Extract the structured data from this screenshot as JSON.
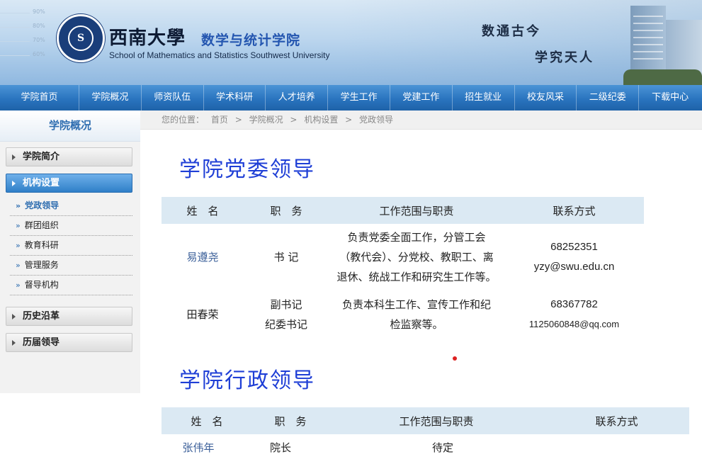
{
  "header": {
    "y_ticks": [
      "90%",
      "80%",
      "70%",
      "60%"
    ],
    "seal_mark": "S",
    "university_name": "西南大學",
    "school_name": "数学与统计学院",
    "school_name_en": "School of Mathematics and Statistics Southwest University",
    "motto_line1": "数通古今",
    "motto_line2": "学究天人"
  },
  "nav": {
    "items": [
      "学院首页",
      "学院概况",
      "师资队伍",
      "学术科研",
      "人才培养",
      "学生工作",
      "党建工作",
      "招生就业",
      "校友风采",
      "二级纪委",
      "下载中心"
    ]
  },
  "sidebar": {
    "title": "学院概况",
    "main_items": [
      "学院简介",
      "机构设置",
      "历史沿革",
      "历届领导"
    ],
    "sub_items": [
      "党政领导",
      "群团组织",
      "教育科研",
      "管理服务",
      "督导机构"
    ],
    "active_main": "机构设置",
    "current_sub": "党政领导",
    "sub_marker": "»"
  },
  "breadcrumb": {
    "prefix": "您的位置：",
    "items": [
      "首页",
      "学院概况",
      "机构设置",
      "党政领导"
    ],
    "separator": ">"
  },
  "party_section": {
    "title": "学院党委领导",
    "headers": [
      "姓　名",
      "职　务",
      "工作范围与职责",
      "联系方式"
    ],
    "rows": [
      {
        "name": "易遵尧",
        "position": [
          "书 记"
        ],
        "duty": [
          "负责党委全面工作，分管工会",
          "（教代会）、分党校、教职工、离",
          "退休、统战工作和研究生工作等。"
        ],
        "phone": "68252351",
        "email": "yzy@swu.edu.cn"
      },
      {
        "name": "田春荣",
        "position": [
          "副书记",
          "纪委书记"
        ],
        "duty": [
          "负责本科生工作、宣传工作和纪",
          "检监察等。"
        ],
        "phone": "68367782",
        "email": "1125060848@qq.com"
      }
    ]
  },
  "admin_section": {
    "title": "学院行政领导",
    "headers": [
      "姓　名",
      "职　务",
      "工作范围与职责",
      "联系方式"
    ],
    "rows": [
      {
        "name": "张伟年",
        "position": "院长",
        "duty": "待定"
      }
    ]
  },
  "colors": {
    "nav_blue": "#2a74bf",
    "title_blue": "#1f3fd6",
    "table_header_bg": "#dbe9f3",
    "sidebar_active": "#2f7fc8",
    "dot_red": "#dd2222"
  }
}
